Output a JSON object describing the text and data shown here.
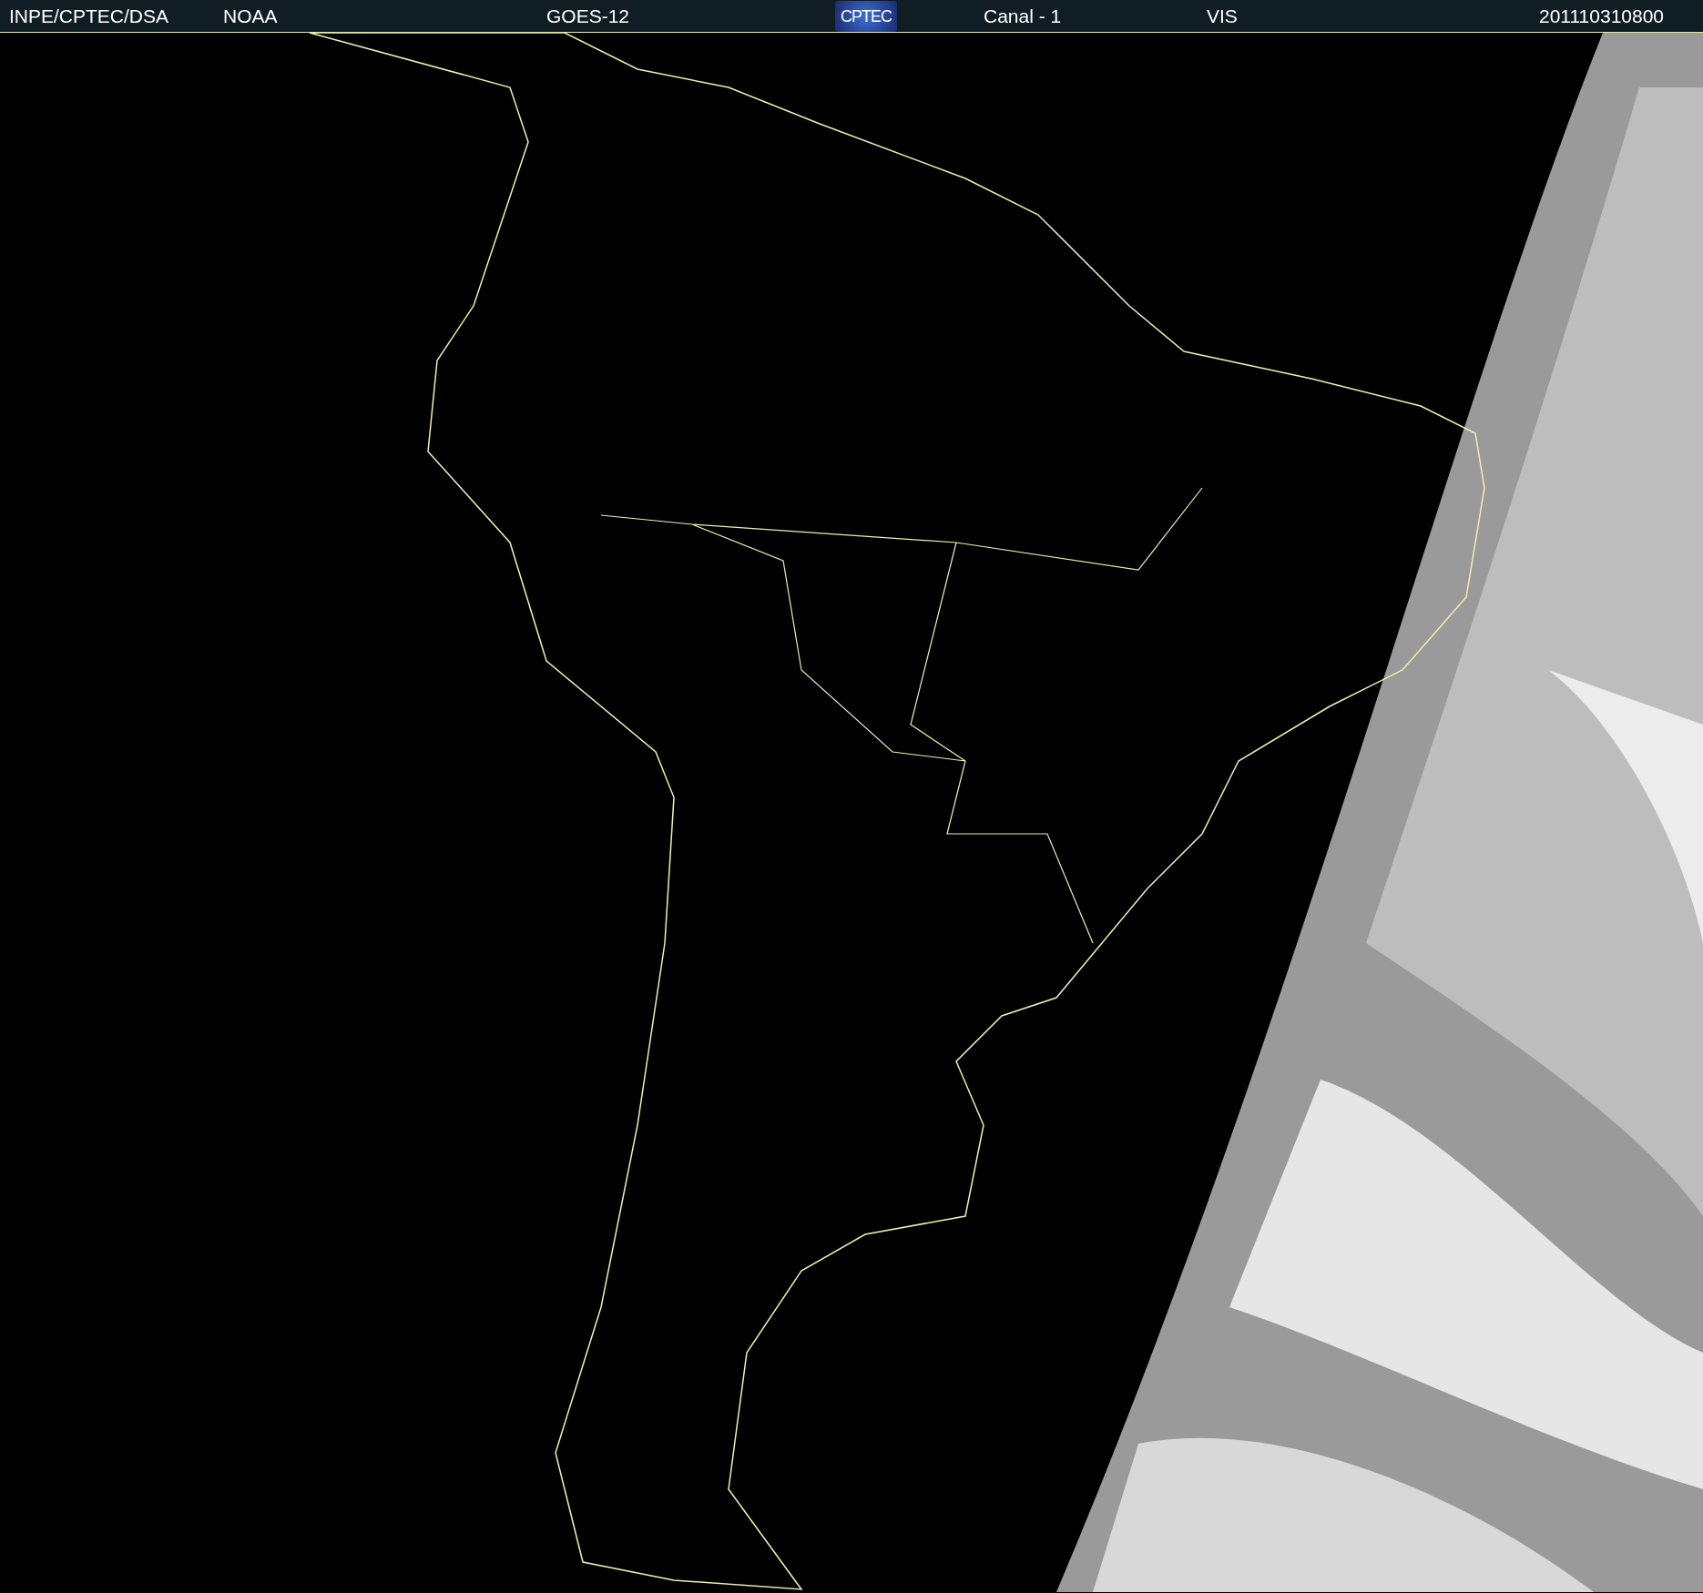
{
  "header": {
    "items": [
      {
        "kind": "text",
        "text": "INPE/CPTEC/DSA"
      },
      {
        "kind": "text",
        "text": "NOAA"
      },
      {
        "kind": "text",
        "text": "GOES-12"
      },
      {
        "kind": "logo",
        "text": "CPTEC"
      },
      {
        "kind": "text",
        "text": "Canal - 1"
      },
      {
        "kind": "text",
        "text": "VIS"
      },
      {
        "kind": "text",
        "text": "201110310800"
      }
    ]
  }
}
